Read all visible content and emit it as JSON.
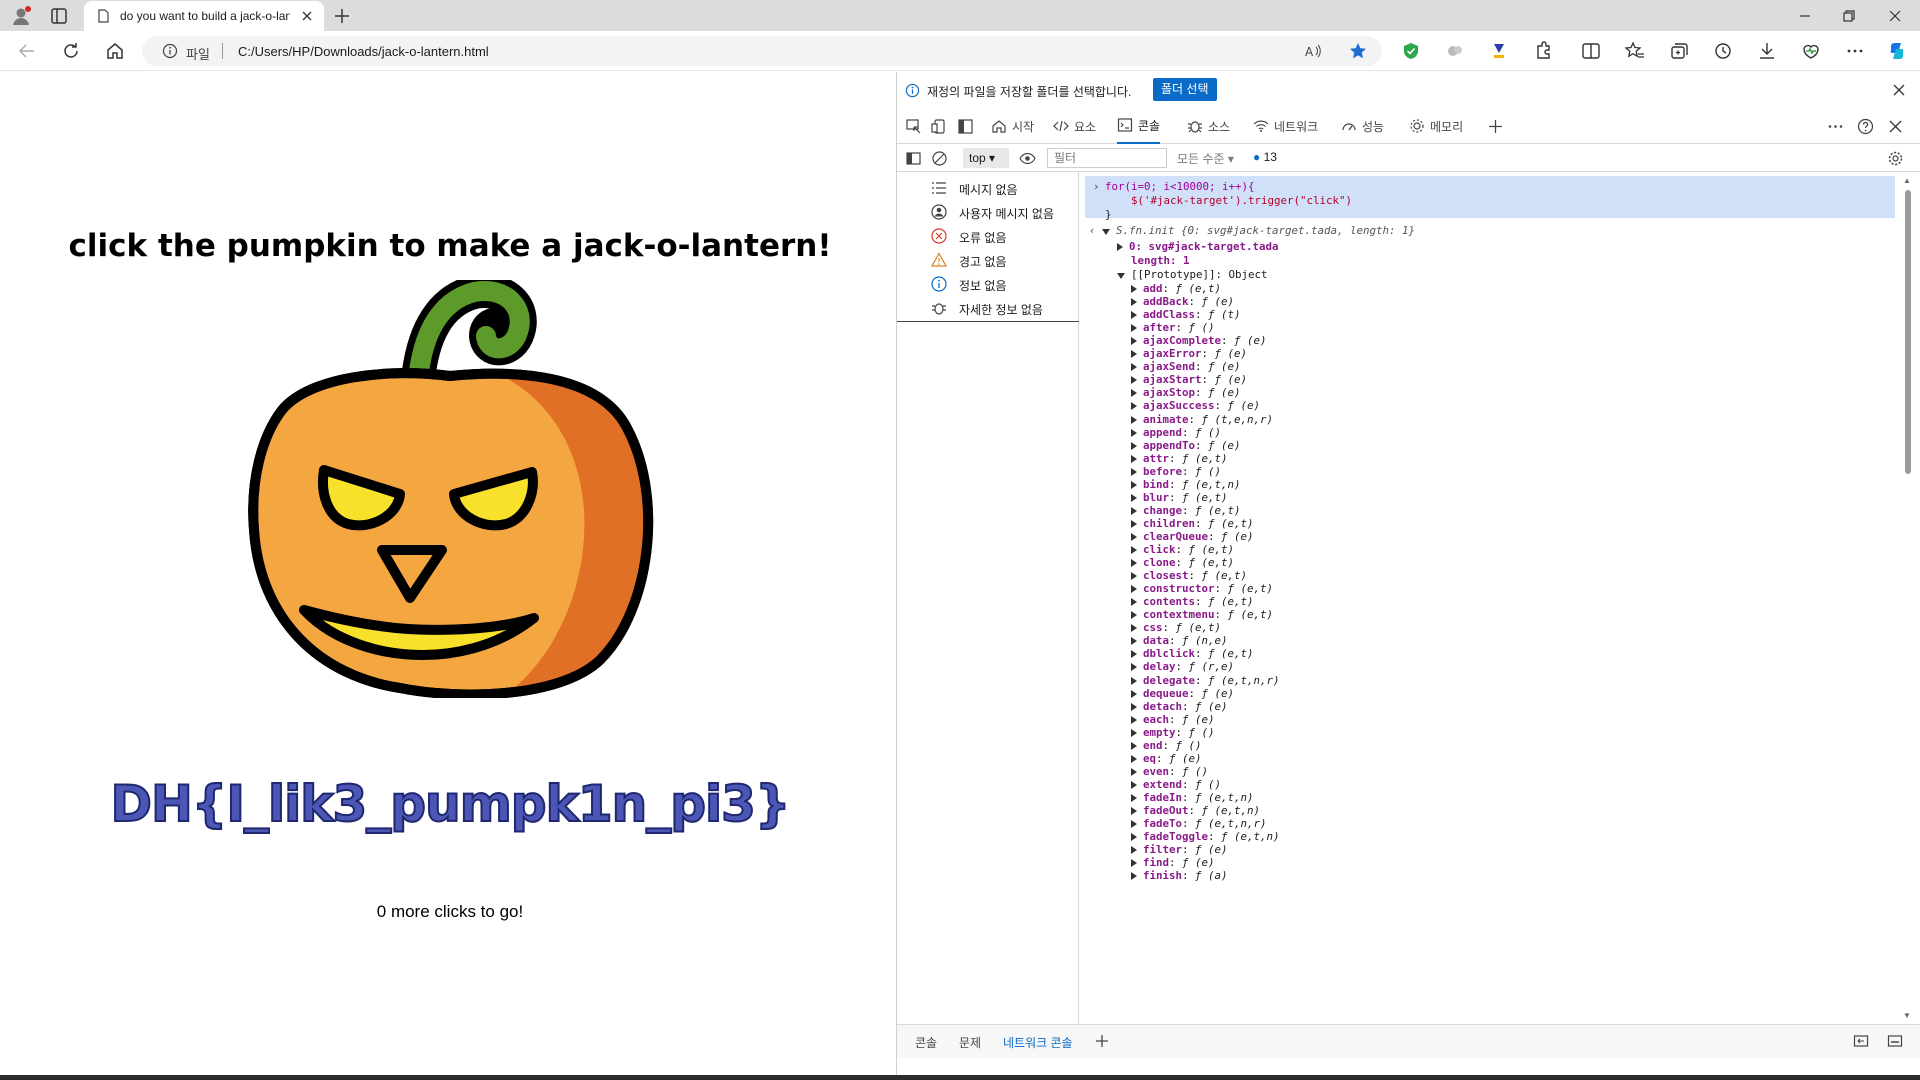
{
  "browser": {
    "tab_title": "do you want to build a jack-o-lan",
    "address_scheme": "파일",
    "address_url": "C:/Users/HP/Downloads/jack-o-lantern.html"
  },
  "page": {
    "heading": "click the pumpkin to make a jack-o-lantern!",
    "flag": "DH{I_lik3_pumpk1n_pi3}",
    "counter": "0 more clicks to go!"
  },
  "devtools": {
    "infobar_message": "재정의 파일을 저장할 폴더를 선택합니다.",
    "infobar_button": "폴더 선택",
    "tabs": [
      "시작",
      "요소",
      "콘솔",
      "소스",
      "네트워크",
      "성능",
      "메모리"
    ],
    "console_bar": {
      "context": "top",
      "filter_placeholder": "필터",
      "levels": "모든 수준",
      "issue_count": "13"
    },
    "sidebar": [
      {
        "label": "메시지 없음",
        "icon": "list-icon"
      },
      {
        "label": "사용자 메시지 없음",
        "icon": "user-icon"
      },
      {
        "label": "오류 없음",
        "icon": "error-icon"
      },
      {
        "label": "경고 없음",
        "icon": "warning-icon"
      },
      {
        "label": "정보 없음",
        "icon": "info-icon"
      },
      {
        "label": "자세한 정보 없음",
        "icon": "bug-icon"
      }
    ],
    "command": {
      "line1": "for(i=0; i<10000; i++){",
      "line2": "    $('#jack-target').trigger(\"click\")",
      "line3": "}"
    },
    "result_header": "S.fn.init {0: svg#jack-target.tada, length: 1}",
    "result_item0": "0: svg#jack-target.tada",
    "result_length": "length: 1",
    "prototype": "[[Prototype]]: Object",
    "methods": [
      {
        "k": "add",
        "v": "ƒ (e,t)"
      },
      {
        "k": "addBack",
        "v": "ƒ (e)"
      },
      {
        "k": "addClass",
        "v": "ƒ (t)"
      },
      {
        "k": "after",
        "v": "ƒ ()"
      },
      {
        "k": "ajaxComplete",
        "v": "ƒ (e)"
      },
      {
        "k": "ajaxError",
        "v": "ƒ (e)"
      },
      {
        "k": "ajaxSend",
        "v": "ƒ (e)"
      },
      {
        "k": "ajaxStart",
        "v": "ƒ (e)"
      },
      {
        "k": "ajaxStop",
        "v": "ƒ (e)"
      },
      {
        "k": "ajaxSuccess",
        "v": "ƒ (e)"
      },
      {
        "k": "animate",
        "v": "ƒ (t,e,n,r)"
      },
      {
        "k": "append",
        "v": "ƒ ()"
      },
      {
        "k": "appendTo",
        "v": "ƒ (e)"
      },
      {
        "k": "attr",
        "v": "ƒ (e,t)"
      },
      {
        "k": "before",
        "v": "ƒ ()"
      },
      {
        "k": "bind",
        "v": "ƒ (e,t,n)"
      },
      {
        "k": "blur",
        "v": "ƒ (e,t)"
      },
      {
        "k": "change",
        "v": "ƒ (e,t)"
      },
      {
        "k": "children",
        "v": "ƒ (e,t)"
      },
      {
        "k": "clearQueue",
        "v": "ƒ (e)"
      },
      {
        "k": "click",
        "v": "ƒ (e,t)"
      },
      {
        "k": "clone",
        "v": "ƒ (e,t)"
      },
      {
        "k": "closest",
        "v": "ƒ (e,t)"
      },
      {
        "k": "constructor",
        "v": "ƒ (e,t)"
      },
      {
        "k": "contents",
        "v": "ƒ (e,t)"
      },
      {
        "k": "contextmenu",
        "v": "ƒ (e,t)"
      },
      {
        "k": "css",
        "v": "ƒ (e,t)"
      },
      {
        "k": "data",
        "v": "ƒ (n,e)"
      },
      {
        "k": "dblclick",
        "v": "ƒ (e,t)"
      },
      {
        "k": "delay",
        "v": "ƒ (r,e)"
      },
      {
        "k": "delegate",
        "v": "ƒ (e,t,n,r)"
      },
      {
        "k": "dequeue",
        "v": "ƒ (e)"
      },
      {
        "k": "detach",
        "v": "ƒ (e)"
      },
      {
        "k": "each",
        "v": "ƒ (e)"
      },
      {
        "k": "empty",
        "v": "ƒ ()"
      },
      {
        "k": "end",
        "v": "ƒ ()"
      },
      {
        "k": "eq",
        "v": "ƒ (e)"
      },
      {
        "k": "even",
        "v": "ƒ ()"
      },
      {
        "k": "extend",
        "v": "ƒ ()"
      },
      {
        "k": "fadeIn",
        "v": "ƒ (e,t,n)"
      },
      {
        "k": "fadeOut",
        "v": "ƒ (e,t,n)"
      },
      {
        "k": "fadeTo",
        "v": "ƒ (e,t,n,r)"
      },
      {
        "k": "fadeToggle",
        "v": "ƒ (e,t,n)"
      },
      {
        "k": "filter",
        "v": "ƒ (e)"
      },
      {
        "k": "find",
        "v": "ƒ (e)"
      },
      {
        "k": "finish",
        "v": "ƒ (a)"
      }
    ],
    "drawer_tabs": [
      "콘솔",
      "문제",
      "네트워크 콘솔"
    ]
  }
}
